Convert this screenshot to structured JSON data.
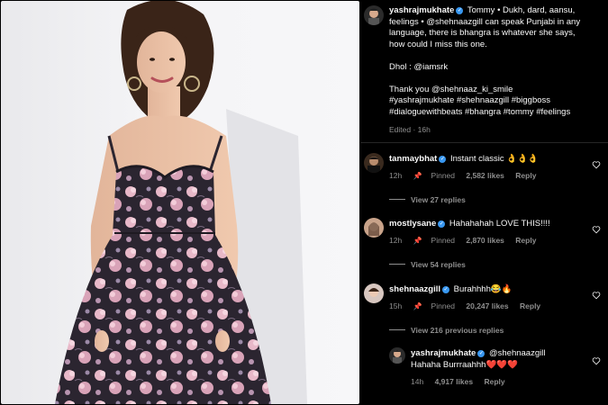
{
  "post": {
    "username": "yashrajmukhate",
    "caption_lines": [
      "Tommy • Dukh, dard, aansu,",
      "feelings • @shehnaazgill can speak Punjabi in any",
      "language, there is bhangra is whatever she says,",
      "how could I miss this one."
    ],
    "dhol_line": "Dhol : @iamsrk",
    "thanks_line": "Thank you @shehnaaz_ki_smile",
    "hashtag_lines": [
      "#yashrajmukhate #shehnaazgill #biggboss",
      "#dialoguewithbeats #bhangra #tommy #feelings"
    ],
    "edited": "Edited · 16h"
  },
  "comments": [
    {
      "username": "tanmaybhat",
      "text": "Instant classic 👌👌👌",
      "time": "12h",
      "pinned": "Pinned",
      "likes": "2,582 likes",
      "reply": "Reply",
      "view_replies": "View 27 replies",
      "avatar_color": "#3a2a1e"
    },
    {
      "username": "mostlysane",
      "text": "Hahahahah LOVE THIS!!!!",
      "time": "12h",
      "pinned": "Pinned",
      "likes": "2,870 likes",
      "reply": "Reply",
      "view_replies": "View 54 replies",
      "avatar_color": "#c9a38a"
    },
    {
      "username": "shehnaazgill",
      "text": "Burahhhh😂🔥",
      "time": "15h",
      "pinned": "Pinned",
      "likes": "20,247 likes",
      "reply": "Reply",
      "view_replies": "View 216 previous replies",
      "avatar_color": "#d8c7c0"
    }
  ],
  "reply": {
    "username": "yashrajmukhate",
    "mention": "@shehnaazgill",
    "text": "Hahaha Burrraahhh❤️❤️❤️",
    "time": "14h",
    "likes": "4,917 likes",
    "reply": "Reply"
  },
  "colors": {
    "verified": "#3897f0",
    "muted": "#8e8e8e",
    "bg": "#000000"
  }
}
